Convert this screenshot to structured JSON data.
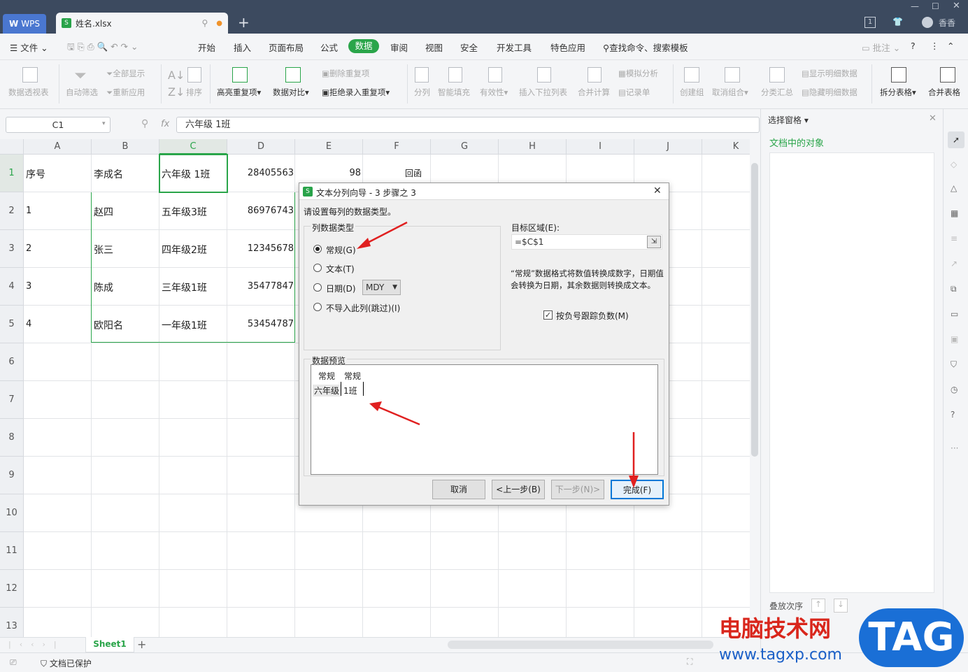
{
  "titlebar": {
    "app_tab": "WPS",
    "file_tab": "姓名.xlsx",
    "notif_count": "1",
    "user_name": "香香"
  },
  "menubar": {
    "file": "文件",
    "items": [
      "开始",
      "插入",
      "页面布局",
      "公式",
      "数据",
      "审阅",
      "视图",
      "安全",
      "开发工具",
      "特色应用"
    ],
    "active": "数据",
    "search": "查找命令、搜索模板",
    "comment": "批注"
  },
  "ribbon": {
    "pivot": "数据透视表",
    "autofilter": "自动筛选",
    "show_all": "全部显示",
    "reapply": "重新应用",
    "sort": "排序",
    "highlight_dup": "高亮重复项",
    "compare": "数据对比",
    "delete_dup": "删除重复项",
    "reject_dup": "拒绝录入重复项",
    "split": "分列",
    "smart_fill": "智能填充",
    "validity": "有效性",
    "dropdown": "插入下拉列表",
    "consolidate": "合并计算",
    "simulate": "模拟分析",
    "record": "记录单",
    "create_group": "创建组",
    "ungroup": "取消组合",
    "subtotal": "分类汇总",
    "show_detail": "显示明细数据",
    "hide_detail": "隐藏明细数据",
    "split_table": "拆分表格",
    "merge_table": "合并表格"
  },
  "formula_bar": {
    "name_box": "C1",
    "fx": "fx",
    "content": "六年级  1班"
  },
  "grid": {
    "columns": [
      "A",
      "B",
      "C",
      "D",
      "E",
      "F",
      "G",
      "H",
      "I",
      "J",
      "K"
    ],
    "rows": [
      "1",
      "2",
      "3",
      "4",
      "5",
      "6",
      "7",
      "8",
      "9",
      "10",
      "11",
      "12",
      "13"
    ],
    "data": [
      [
        "序号",
        "李成名",
        "六年级  1班",
        "28405563",
        "98",
        "回函"
      ],
      [
        "1",
        "赵四",
        "五年级3班",
        "86976743"
      ],
      [
        "2",
        "张三",
        "四年级2班",
        "12345678"
      ],
      [
        "3",
        "陈成",
        "三年级1班",
        "35477847"
      ],
      [
        "4",
        "欧阳名",
        "一年级1班",
        "53454787"
      ]
    ]
  },
  "sheet": {
    "tab": "Sheet1"
  },
  "status": {
    "protected": "文档已保护"
  },
  "sidepane": {
    "title": "选择窗格",
    "subtitle": "文档中的对象",
    "order": "叠放次序"
  },
  "dialog": {
    "title": "文本分列向导 - 3 步骤之 3",
    "instruction": "请设置每列的数据类型。",
    "group_label": "列数据类型",
    "options": [
      "常规(G)",
      "文本(T)",
      "日期(D)",
      "不导入此列(跳过)(I)"
    ],
    "selected": "常规(G)",
    "date_format": "MDY",
    "target_label": "目标区域(E):",
    "target_value": "=$C$1",
    "description": "“常规”数据格式将数值转换成数字，日期值会转换为日期，其余数据则转换成文本。",
    "negative_check": "按负号跟踪负数(M)",
    "negative_checked": true,
    "preview_label": "数据预览",
    "preview_headers": [
      "常规",
      "常规"
    ],
    "preview_row": [
      "六年级",
      "1班"
    ],
    "buttons": {
      "cancel": "取消",
      "prev": "<上一步(B)",
      "next": "下一步(N)>",
      "finish": "完成(F)"
    }
  },
  "watermark": {
    "text": "电脑技术网",
    "url": "www.tagxp.com",
    "logo": "TAG"
  },
  "colors": {
    "accent": "#2aa54a",
    "titlebar": "#3c4a5f",
    "arrow": "#e02020"
  }
}
